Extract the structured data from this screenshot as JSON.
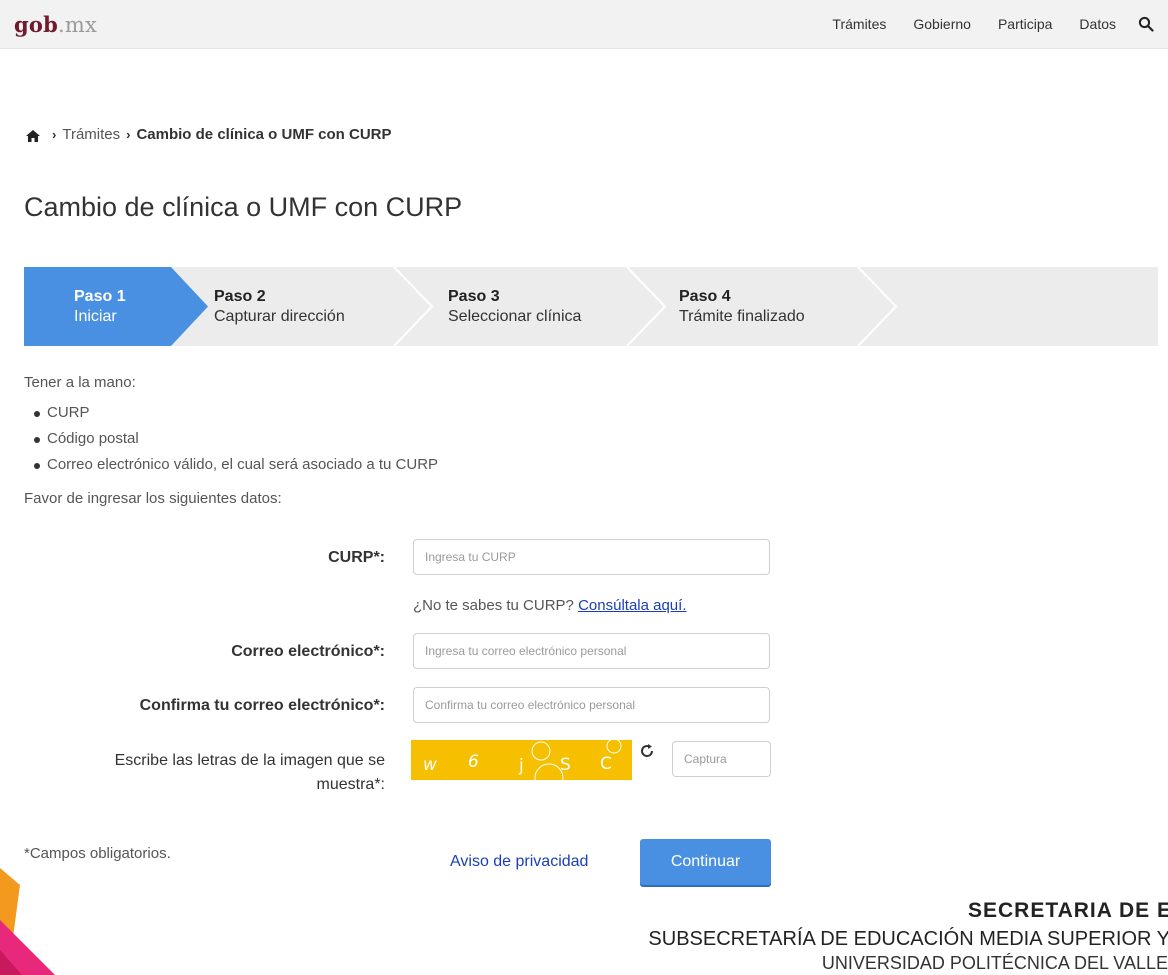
{
  "header": {
    "logo_main": "gob",
    "logo_ext": ".mx",
    "nav": [
      "Trámites",
      "Gobierno",
      "Participa",
      "Datos"
    ],
    "search_icon": "search-icon"
  },
  "breadcrumb": {
    "home_icon": "home-icon",
    "items": [
      "Trámites"
    ],
    "current": "Cambio de clínica o UMF con CURP"
  },
  "page_title": "Cambio de clínica o UMF con CURP",
  "steps": [
    {
      "num": "Paso 1",
      "label": "Iniciar",
      "active": true
    },
    {
      "num": "Paso 2",
      "label": "Capturar dirección",
      "active": false
    },
    {
      "num": "Paso 3",
      "label": "Seleccionar clínica",
      "active": false
    },
    {
      "num": "Paso 4",
      "label": "Trámite finalizado",
      "active": false
    }
  ],
  "intro": "Tener a la mano:",
  "requirements": [
    "CURP",
    "Código postal",
    "Correo electrónico válido, el cual será asociado a tu CURP"
  ],
  "instructions": "Favor de ingresar los siguientes datos:",
  "form": {
    "curp_label": "CURP*:",
    "curp_placeholder": "Ingresa tu CURP",
    "curp_hint": "¿No te sabes tu CURP?",
    "curp_hint_link": "Consúltala aquí.",
    "email_label": "Correo electrónico*:",
    "email_placeholder": "Ingresa tu correo electrónico personal",
    "confirm_label": "Confirma tu correo electrónico*:",
    "confirm_placeholder": "Confirma tu correo electrónico personal",
    "captcha_label_1": "Escribe las letras de la imagen que se",
    "captcha_label_2": "muestra*:",
    "captcha_text": [
      "w",
      "6",
      "j",
      "S",
      "C"
    ],
    "captcha_placeholder": "Captura",
    "refresh_icon": "refresh-icon"
  },
  "required_note": "*Campos obligatorios.",
  "privacy_link": "Aviso de privacidad",
  "continue_button": "Continuar",
  "footer": {
    "line1": "SECRETARIA DE E",
    "line2": "SUBSECRETARÍA DE EDUCACIÓN MEDIA SUPERIOR Y",
    "line3": "UNIVERSIDAD POLITÉCNICA DEL VALLE"
  },
  "colors": {
    "accent": "#4a90e2",
    "brand": "#6f1a2d",
    "captcha_bg": "#f6c000",
    "link": "#1a3fb8"
  }
}
